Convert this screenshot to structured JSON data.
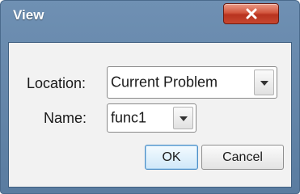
{
  "window": {
    "title": "View",
    "close_icon": "close-icon"
  },
  "form": {
    "location_label": "Location:",
    "location_value": "Current Problem",
    "name_label": "Name:",
    "name_value": "func1",
    "dropdown_icon": "chevron-down-icon"
  },
  "buttons": {
    "ok": "OK",
    "cancel": "Cancel"
  },
  "colors": {
    "titlebar": "#6f90b3",
    "close_button": "#c6472f",
    "ok_border": "#4d8ec5",
    "client_bg": "#f2f2f2"
  }
}
